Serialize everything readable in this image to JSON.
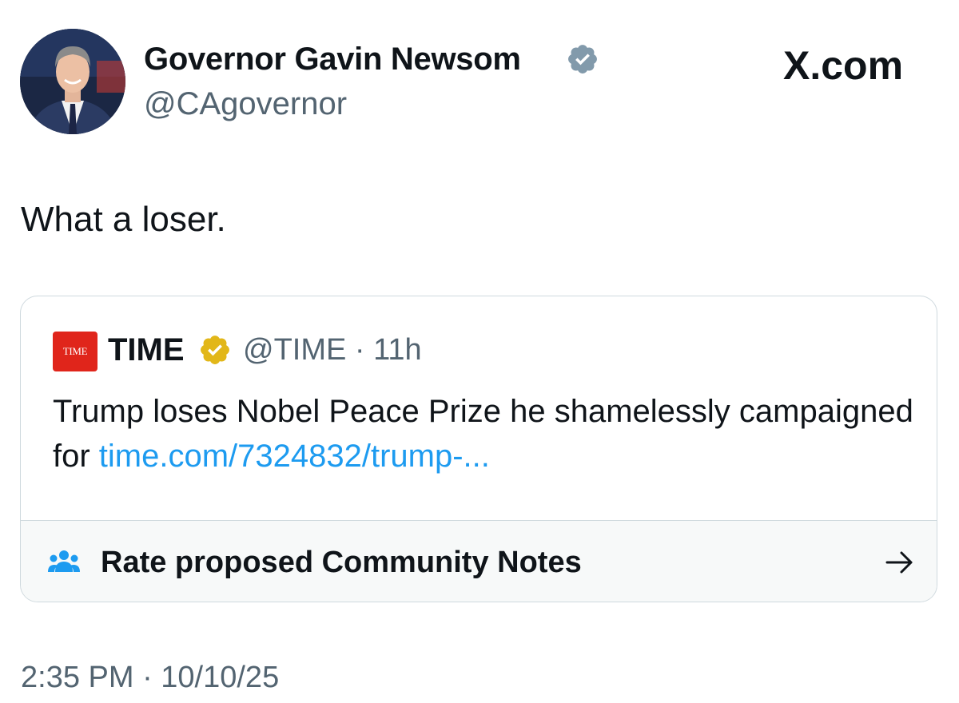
{
  "author": {
    "name": "Governor Gavin Newsom",
    "handle": "@CAgovernor",
    "avatar_icon": "profile-photo",
    "verified_badge": "gray-verified-badge"
  },
  "source": {
    "site": "X.com"
  },
  "tweet": {
    "text": "What a loser.",
    "timestamp": "2:35 PM · 10/10/25"
  },
  "quote": {
    "logo_text": "TIME",
    "name": "TIME",
    "verified_badge": "gold-verified-badge",
    "meta": "@TIME · 11h",
    "text": "Trump loses Nobel Peace Prize he shamelessly campaigned for ",
    "link": "time.com/7324832/trump-..."
  },
  "community_notes": {
    "label": "Rate proposed Community Notes",
    "icon": "people-icon",
    "arrow_icon": "arrow-right-icon"
  },
  "colors": {
    "text": "#0f1419",
    "secondary_text": "#536471",
    "link": "#1d9bf0",
    "border": "#cfd9de",
    "time_red": "#e0251b",
    "gold_badge": "#e2b719",
    "gray_badge": "#829aab"
  }
}
